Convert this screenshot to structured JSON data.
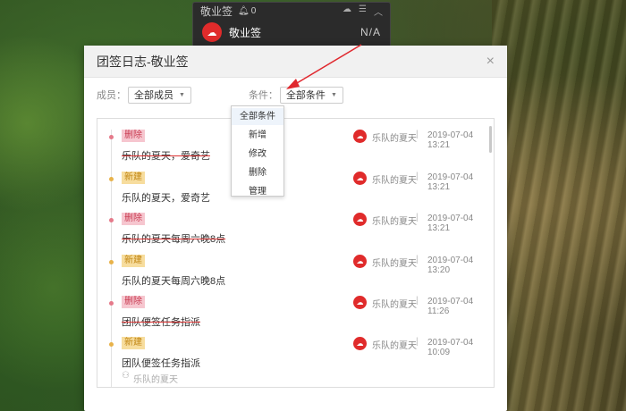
{
  "widget": {
    "title": "敬业签",
    "bell_count": "0",
    "icons": [
      "cloud-icon",
      "menu-icon",
      "collapse-icon"
    ],
    "app_name": "敬业签",
    "status": "N/A"
  },
  "dialog": {
    "title": "团签日志-敬业签",
    "close_symbol": "×"
  },
  "filters": {
    "member_label": "成员：",
    "member_value": "全部成员",
    "condition_label": "条件：",
    "condition_value": "全部条件"
  },
  "dropdown": {
    "options": [
      "全部条件",
      "新增",
      "修改",
      "删除",
      "管理"
    ]
  },
  "entries": [
    {
      "tag": "删除",
      "type": "delete",
      "user": "乐队的夏天",
      "time": "2019-07-04 13:21",
      "content": "乐队的夏天，爱奇艺"
    },
    {
      "tag": "新建",
      "type": "new",
      "user": "乐队的夏天",
      "time": "2019-07-04 13:21",
      "content": "乐队的夏天，爱奇艺"
    },
    {
      "tag": "删除",
      "type": "delete",
      "user": "乐队的夏天",
      "time": "2019-07-04 13:21",
      "content": "乐队的夏天每周六晚8点"
    },
    {
      "tag": "新建",
      "type": "new",
      "user": "乐队的夏天",
      "time": "2019-07-04 13:20",
      "content": "乐队的夏天每周六晚8点"
    },
    {
      "tag": "删除",
      "type": "delete",
      "user": "乐队的夏天",
      "time": "2019-07-04 11:26",
      "content": "团队便签任务指派"
    },
    {
      "tag": "新建",
      "type": "new",
      "user": "乐队的夏天",
      "time": "2019-07-04 10:09",
      "content": "团队便签任务指派",
      "footer_user": "乐队的夏天"
    }
  ],
  "colors": {
    "accent_red": "#e02b2b",
    "delete_tag_bg": "#f6c6cf",
    "new_tag_bg": "#f7dd9e",
    "arrow_red": "#e0282e"
  }
}
